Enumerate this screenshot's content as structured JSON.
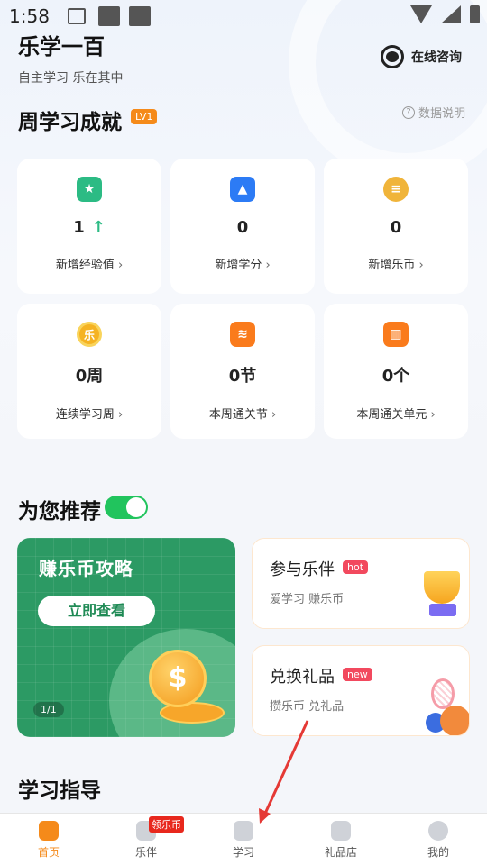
{
  "status_bar": {
    "time": "1:58"
  },
  "header": {
    "title": "乐学一百",
    "subtitle": "自主学习 乐在其中",
    "consult_label": "在线咨询"
  },
  "weekly": {
    "title": "周学习成就",
    "level_badge": "LV1",
    "help_label": "数据说明",
    "cards": [
      {
        "icon": "star-icon",
        "value": "1",
        "trend": "up",
        "label": "新增经验值"
      },
      {
        "icon": "graduation-cap-icon",
        "value": "0",
        "label": "新增学分"
      },
      {
        "icon": "coin-stack-icon",
        "value": "0",
        "label": "新增乐币"
      },
      {
        "icon": "le-coin-icon",
        "icon_text": "乐",
        "value": "0周",
        "label": "连续学习周"
      },
      {
        "icon": "section-icon",
        "value": "0节",
        "label": "本周通关节"
      },
      {
        "icon": "book-icon",
        "value": "0个",
        "label": "本周通关单元"
      }
    ]
  },
  "recommend": {
    "title": "为您推荐",
    "toggle_on": true,
    "promo": {
      "title": "赚乐币攻略",
      "button": "立即查看",
      "pager": "1/1",
      "coin_symbol": "$"
    },
    "items": [
      {
        "title": "参与乐伴",
        "badge": "hot",
        "subtitle": "爱学习 赚乐币"
      },
      {
        "title": "兑换礼品",
        "badge": "new",
        "subtitle": "攒乐币 兑礼品"
      }
    ]
  },
  "guide": {
    "title": "学习指导"
  },
  "bottom_nav": {
    "items": [
      {
        "label": "首页",
        "active": true
      },
      {
        "label": "乐伴",
        "badge": "领乐币"
      },
      {
        "label": "学习"
      },
      {
        "label": "礼品店"
      },
      {
        "label": "我的"
      }
    ]
  },
  "colors": {
    "accent": "#f58a1a",
    "promo_green": "#2c9a64",
    "toggle_green": "#21c45d",
    "badge_red": "#f2495e",
    "annotation_red": "#e53935"
  }
}
